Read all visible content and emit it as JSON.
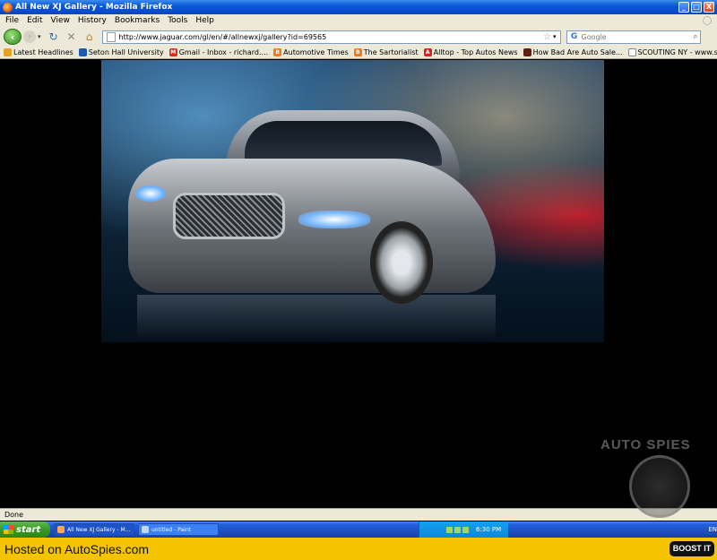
{
  "window": {
    "title": "All New XJ Gallery - Mozilla Firefox",
    "min_glyph": "_",
    "max_glyph": "□",
    "close_glyph": "X"
  },
  "menu": {
    "items": [
      "File",
      "Edit",
      "View",
      "History",
      "Bookmarks",
      "Tools",
      "Help"
    ]
  },
  "nav": {
    "url": "http://www.jaguar.com/gl/en/#/allnewxj/gallery?id=69565",
    "search_placeholder": "Google",
    "search_engine_glyph": "G"
  },
  "bookmarks": [
    {
      "label": "Latest Headlines",
      "color": "#e8a020"
    },
    {
      "label": "Seton Hall University",
      "color": "#1a5ab0"
    },
    {
      "label": "Gmail - Inbox - richard....",
      "color": "#d03020"
    },
    {
      "label": "Automotive Times",
      "color": "#f07820"
    },
    {
      "label": "The Sartorialist",
      "color": "#f07820"
    },
    {
      "label": "Alltop - Top Autos News",
      "color": "#d82020"
    },
    {
      "label": "How Bad Are Auto Sale...",
      "color": "#602010"
    },
    {
      "label": "SCOUTING NY - www.s...",
      "color": "#888888"
    }
  ],
  "status": {
    "text": "Done"
  },
  "taskbar": {
    "start_label": "start",
    "items": [
      {
        "label": "All New XJ Gallery - M...",
        "active": true
      },
      {
        "label": "untitled - Paint",
        "active": false
      }
    ],
    "language": "EN",
    "clock": "6:30 PM"
  },
  "hosted": {
    "text": "Hosted on AutoSpies.com",
    "boost_label": "BOOST IT"
  },
  "watermark": {
    "text": "AUTO SPIES"
  },
  "colors": {
    "titlebar": "#0a56d8",
    "chrome": "#ece9d8",
    "taskbar": "#245edb",
    "hosted_bar": "#f5c400"
  }
}
